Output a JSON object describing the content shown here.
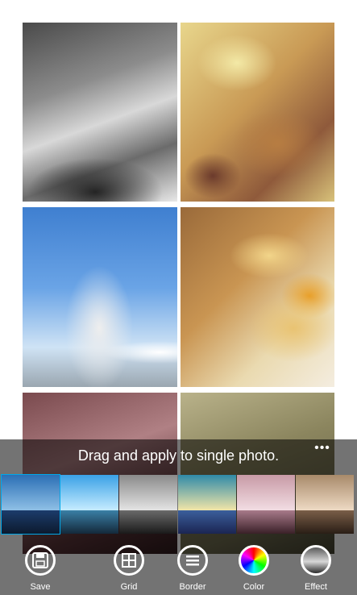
{
  "collage": {
    "photos": [
      {
        "id": "bike",
        "subject": "bicycle"
      },
      {
        "id": "food",
        "subject": "food"
      },
      {
        "id": "windmill",
        "subject": "windmill"
      },
      {
        "id": "sandwich",
        "subject": "sandwich"
      },
      {
        "id": "bottom-left",
        "subject": "photo"
      },
      {
        "id": "bottom-right",
        "subject": "photo"
      }
    ]
  },
  "filter_panel": {
    "hint": "Drag and apply to single photo.",
    "more_label": "•••",
    "filters": [
      {
        "name": "filter-1",
        "selected": true
      },
      {
        "name": "filter-2",
        "selected": false
      },
      {
        "name": "filter-3",
        "selected": false
      },
      {
        "name": "filter-4",
        "selected": false
      },
      {
        "name": "filter-5",
        "selected": false
      },
      {
        "name": "filter-6",
        "selected": false
      }
    ]
  },
  "toolbar": {
    "save_label": "Save",
    "grid_label": "Grid",
    "border_label": "Border",
    "color_label": "Color",
    "effect_label": "Effect"
  },
  "colors": {
    "selection": "#00a8e8",
    "overlay": "rgba(0,0,0,0.55)",
    "icon": "#ffffff"
  }
}
